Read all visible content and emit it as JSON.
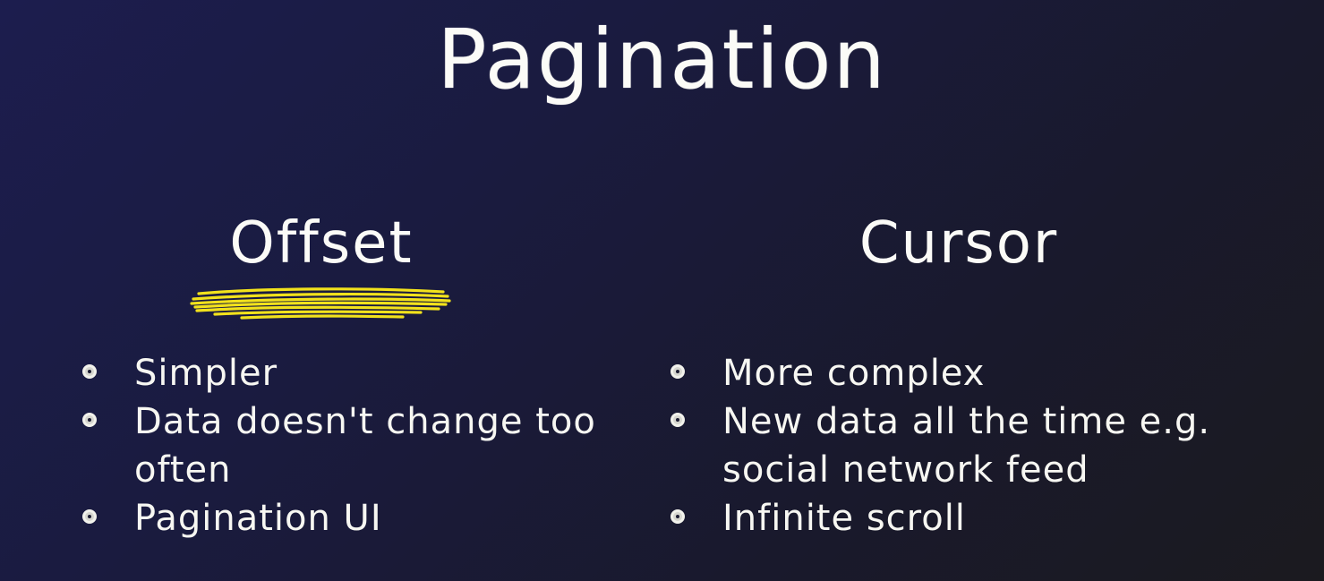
{
  "title": "Pagination",
  "columns": [
    {
      "heading": "Offset",
      "highlighted": true,
      "items": [
        {
          "text": "Simpler"
        },
        {
          "text": "Data doesn't change too often"
        },
        {
          "text": "Pagination UI"
        }
      ]
    },
    {
      "heading": "Cursor",
      "highlighted": false,
      "items": [
        {
          "text": "More complex"
        },
        {
          "text": "New data all the time e.g. social network feed"
        },
        {
          "text": "Infinite scroll"
        }
      ]
    }
  ],
  "colors": {
    "background_start": "#1c1d4e",
    "background_end": "#1b1a1f",
    "text": "#f7f7f2",
    "highlight": "#f2e21c"
  },
  "icons": {
    "bullet": "circle-bullet-icon",
    "underline": "yellow-scribble-underline"
  }
}
